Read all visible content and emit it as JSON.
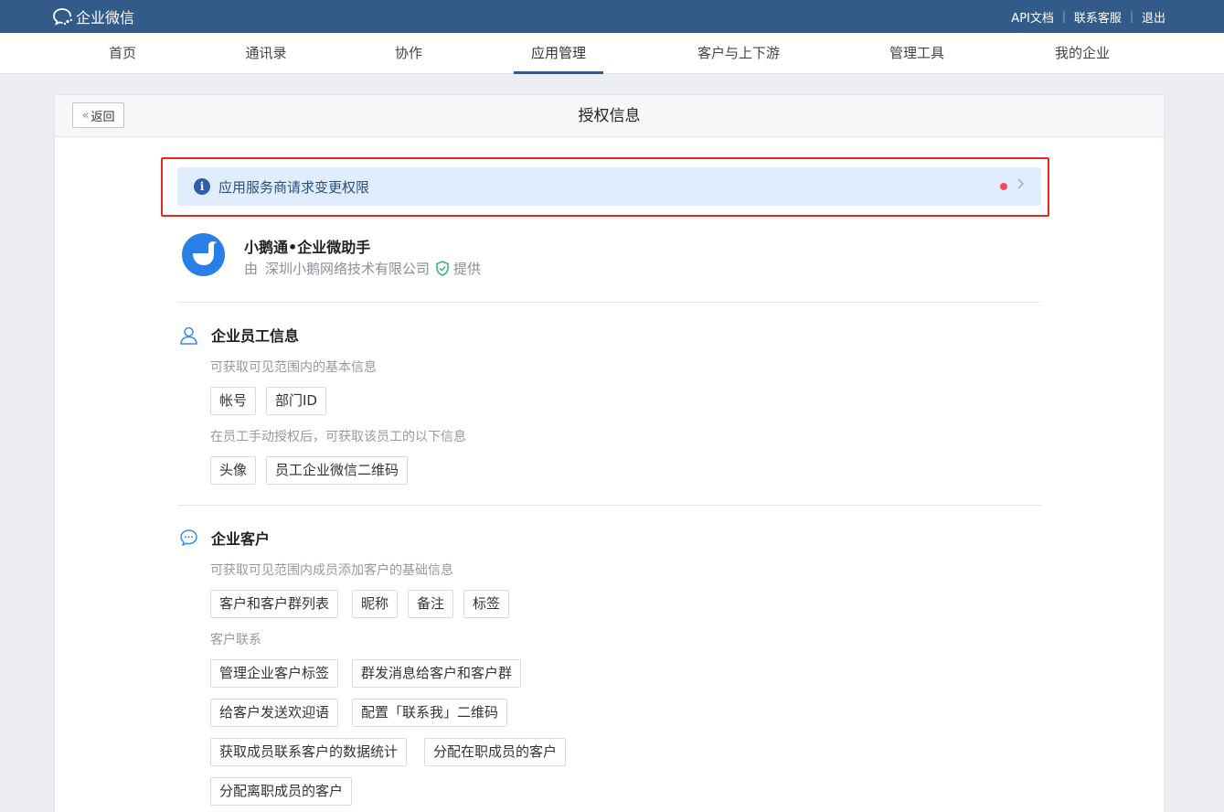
{
  "topbar": {
    "brand": "企业微信",
    "links": [
      "API文档",
      "联系客服",
      "退出"
    ]
  },
  "nav": {
    "items": [
      "首页",
      "通讯录",
      "协作",
      "应用管理",
      "客户与上下游",
      "管理工具",
      "我的企业"
    ],
    "active": "应用管理"
  },
  "page": {
    "back_label": "返回",
    "title": "授权信息"
  },
  "notice": {
    "text": "应用服务商请求变更权限"
  },
  "app": {
    "name": "小鹅通•企业微助手",
    "vendor_prefix": "由",
    "vendor": "深圳小鹅网络技术有限公司",
    "vendor_suffix": "提供"
  },
  "employee": {
    "title": "企业员工信息",
    "hint1": "可获取可见范围内的基本信息",
    "tags1": [
      "帐号",
      "部门ID"
    ],
    "hint2": "在员工手动授权后，可获取该员工的以下信息",
    "tags2": [
      "头像",
      "员工企业微信二维码"
    ]
  },
  "customer": {
    "title": "企业客户",
    "hint1": "可获取可见范围内成员添加客户的基础信息",
    "tags1": [
      "客户和客户群列表",
      "昵称",
      "备注",
      "标签"
    ],
    "hint2": "客户联系",
    "tags2": [
      "管理企业客户标签",
      "群发消息给客户和客户群",
      "给客户发送欢迎语",
      "配置「联系我」二维码",
      "获取成员联系客户的数据统计",
      "分配在职成员的客户",
      "分配离职成员的客户"
    ]
  },
  "colors": {
    "topbar": "#335b8a",
    "notice_bg": "#e0edfc",
    "highlight": "#e8281e",
    "app_avatar": "#2a7fe6"
  }
}
